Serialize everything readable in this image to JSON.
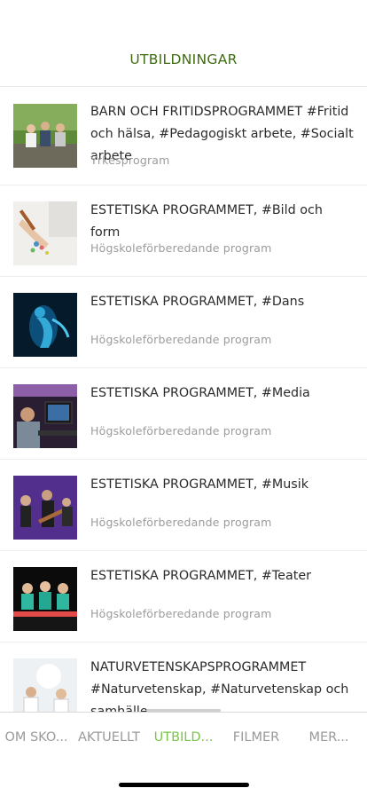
{
  "header": {
    "title": "UTBILDNINGAR"
  },
  "items": [
    {
      "title": "BARN OCH FRITIDSPROGRAMMET #Fritid och hälsa, #Pedagogiskt arbete, #Socialt arbete",
      "subtitle": "Yrkesprogram"
    },
    {
      "title": "ESTETISKA PROGRAMMET, #Bild och form",
      "subtitle": "Högskoleförberedande program"
    },
    {
      "title": "ESTETISKA PROGRAMMET, #Dans",
      "subtitle": "Högskoleförberedande program"
    },
    {
      "title": "ESTETISKA PROGRAMMET, #Media",
      "subtitle": "Högskoleförberedande program"
    },
    {
      "title": "ESTETISKA PROGRAMMET, #Musik",
      "subtitle": "Högskoleförberedande program"
    },
    {
      "title": "ESTETISKA PROGRAMMET, #Teater",
      "subtitle": "Högskoleförberedande program"
    },
    {
      "title": "NATURVETENSKAPSPROGRAMMET #Naturvetenskap, #Naturvetenskap och samhälle",
      "subtitle": ""
    }
  ],
  "tabs": [
    {
      "label": "OM SKO..."
    },
    {
      "label": "AKTUELLT"
    },
    {
      "label": "UTBILD...",
      "active": true
    },
    {
      "label": "FILMER"
    },
    {
      "label": "MER..."
    }
  ],
  "colors": {
    "header_title": "#3f6b12",
    "active_tab": "#7bc44a",
    "inactive_tab": "#9a9a9a"
  }
}
